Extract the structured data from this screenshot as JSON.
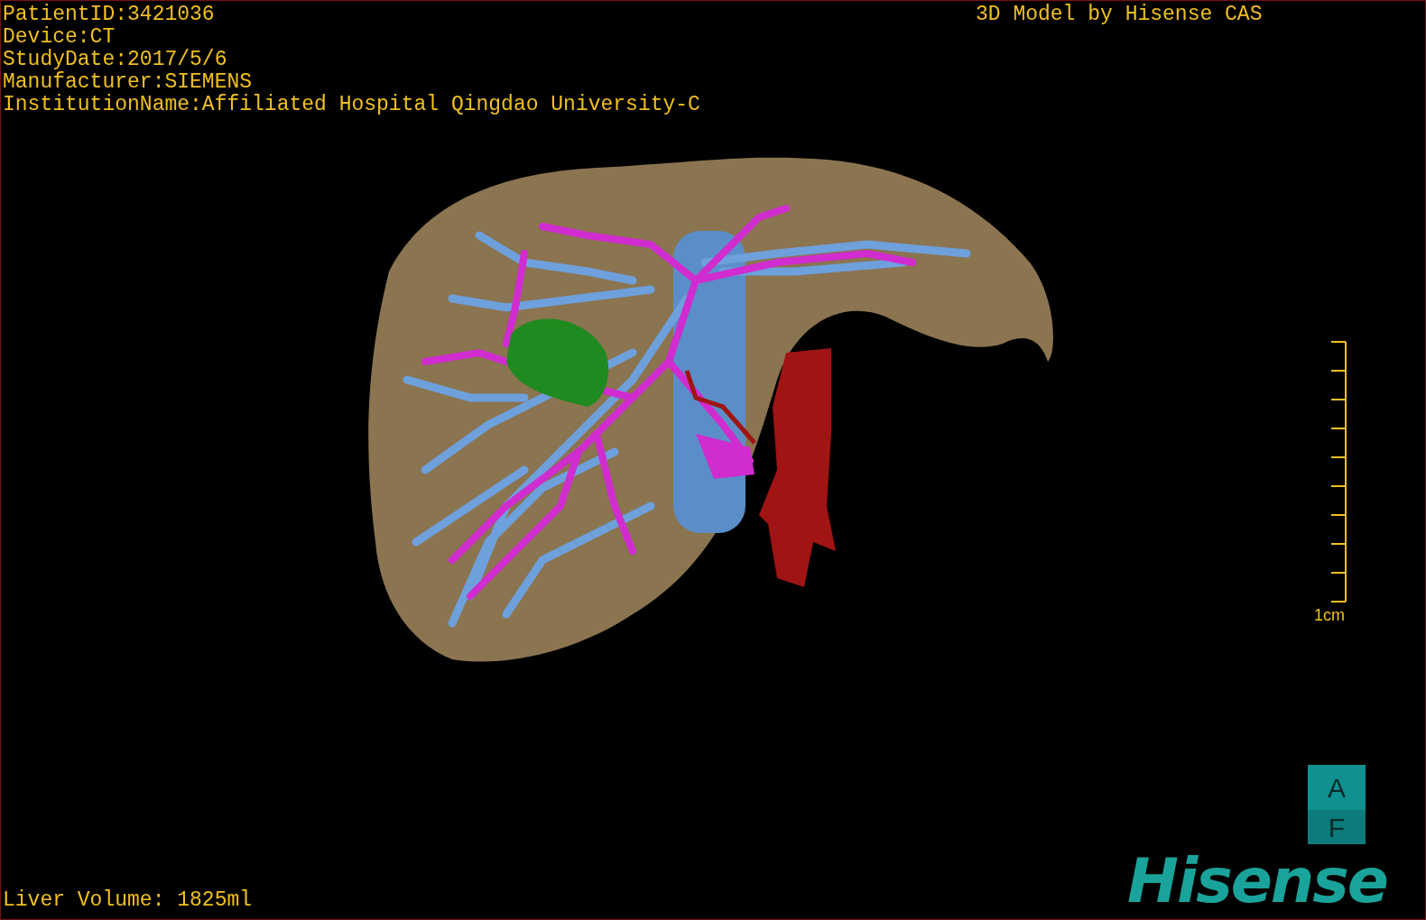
{
  "header_info": [
    "PatientID:3421036",
    "Device:CT",
    "StudyDate:2017/5/6",
    "Manufacturer:SIEMENS",
    "InstitutionName:Affiliated Hospital Qingdao University-C"
  ],
  "model_credit": "3D Model by Hisense CAS",
  "scale_bar": {
    "label": "1cm"
  },
  "orientation_cube": {
    "top": "A",
    "bottom": "F"
  },
  "logo": "Hisense",
  "liver_volume": "Liver Volume: 1825ml"
}
